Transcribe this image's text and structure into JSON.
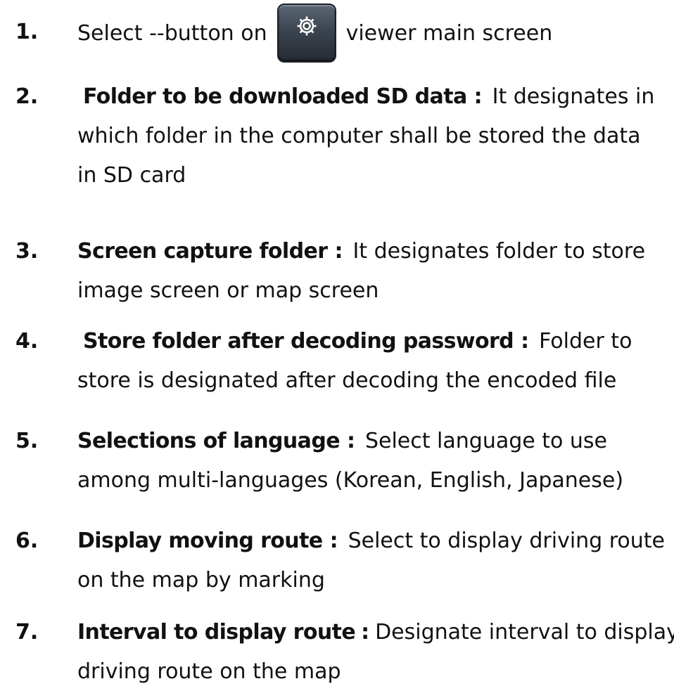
{
  "steps": [
    {
      "number": "1.",
      "before_icon": "Select --button on",
      "icon": "gear-icon",
      "after_icon": "viewer main screen"
    },
    {
      "number": "2.",
      "term": "Folder to be downloaded SD data",
      "separator": ":",
      "lines": [
        "It designates in",
        "which folder in the computer shall be stored the data",
        "in SD card"
      ]
    },
    {
      "number": "3.",
      "term": "Screen capture folder",
      "separator": ":",
      "lines": [
        "It designates folder to store",
        "image screen or map screen"
      ]
    },
    {
      "number": "4.",
      "term": "Store folder after decoding password",
      "separator": ":",
      "lines": [
        "Folder to",
        "store is designated after decoding the encoded file"
      ]
    },
    {
      "number": "5.",
      "term": "Selections of language",
      "separator": ":",
      "lines": [
        "Select language to use",
        "among multi-languages (Korean, English, Japanese)"
      ]
    },
    {
      "number": "6.",
      "term": "Display moving route",
      "separator": ":",
      "lines": [
        "Select to display driving route",
        "on the map by marking"
      ]
    },
    {
      "number": "7.",
      "term": "Interval to display route",
      "separator": ":",
      "lines": [
        "Designate interval to display",
        "driving route on the map"
      ]
    }
  ],
  "colors": {
    "text": "#111111",
    "button_top": "#5c6775",
    "button_bottom": "#252b33"
  }
}
